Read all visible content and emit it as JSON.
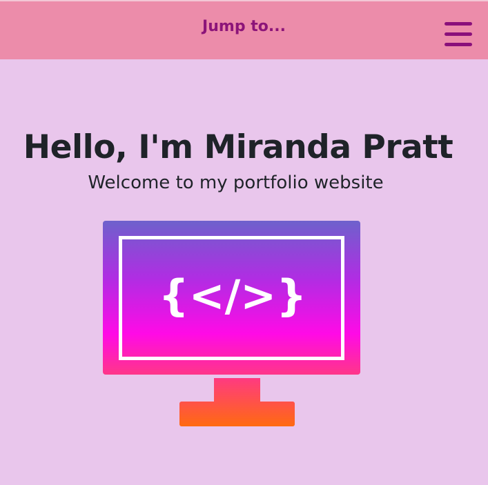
{
  "nav": {
    "jump_label": "Jump to...",
    "menu_icon": "hamburger-menu-icon",
    "background_color": "#ec8caa",
    "text_color": "#8c1479"
  },
  "hero": {
    "title": "Hello, I'm Miranda Pratt",
    "subtitle": "Welcome to my portfolio website",
    "background_color": "#e9c6ec"
  },
  "illustration": {
    "icon": "computer-monitor-icon",
    "code_symbol": "{</>}",
    "gradient_colors": [
      "#6e61cc",
      "#b02de3",
      "#ff0ae6",
      "#ff3d7a",
      "#ff6a10"
    ]
  }
}
